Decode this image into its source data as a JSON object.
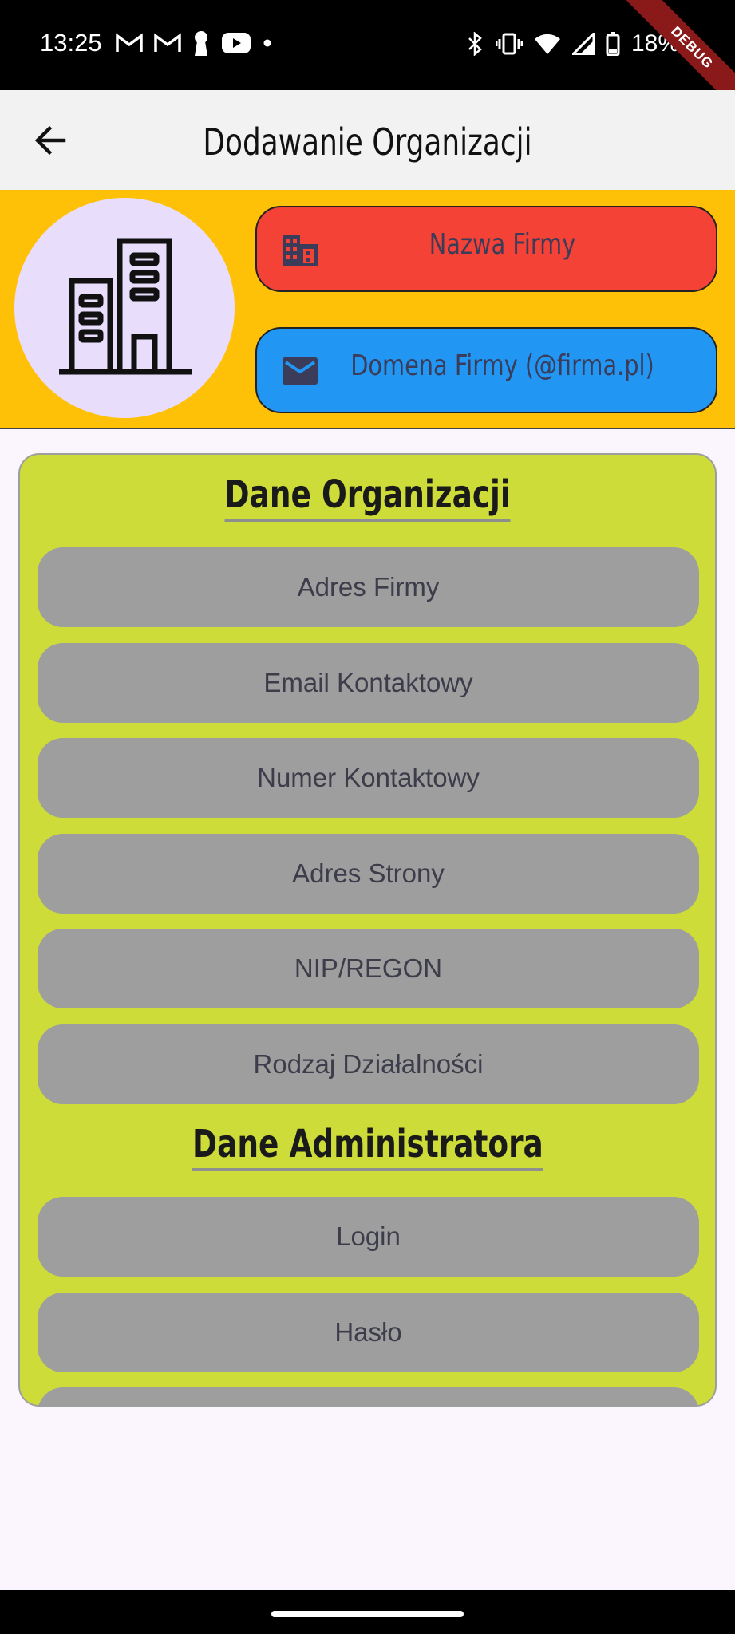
{
  "status_bar": {
    "time": "13:25",
    "battery": "18%",
    "debug_label": "DEBUG",
    "left_icons": [
      "gmail-icon",
      "gmail-icon",
      "keyhole-icon",
      "youtube-icon",
      "dot-icon"
    ],
    "right_icons": [
      "bluetooth-icon",
      "vibrate-icon",
      "wifi-icon",
      "signal-icon",
      "battery-icon"
    ]
  },
  "app_bar": {
    "title": "Dodawanie Organizacji",
    "back_icon": "arrow-left-icon"
  },
  "header": {
    "avatar_icon": "building-icon",
    "company_name_placeholder": "Nazwa Firmy",
    "company_domain_placeholder": "Domena Firmy (@firma.pl)",
    "colors": {
      "background": "#ffc107",
      "name_pill": "#f44336",
      "domain_pill": "#2196f3",
      "avatar": "#e8ddfb"
    }
  },
  "form": {
    "org_section_title": "Dane Organizacji",
    "org_fields": [
      "Adres Firmy",
      "Email Kontaktowy",
      "Numer Kontaktowy",
      "Adres Strony",
      "NIP/REGON",
      "Rodzaj Działalności"
    ],
    "admin_section_title": "Dane Administratora",
    "admin_fields": [
      "Login",
      "Hasło"
    ],
    "colors": {
      "card": "#cddc39",
      "field": "#9e9e9e"
    }
  }
}
